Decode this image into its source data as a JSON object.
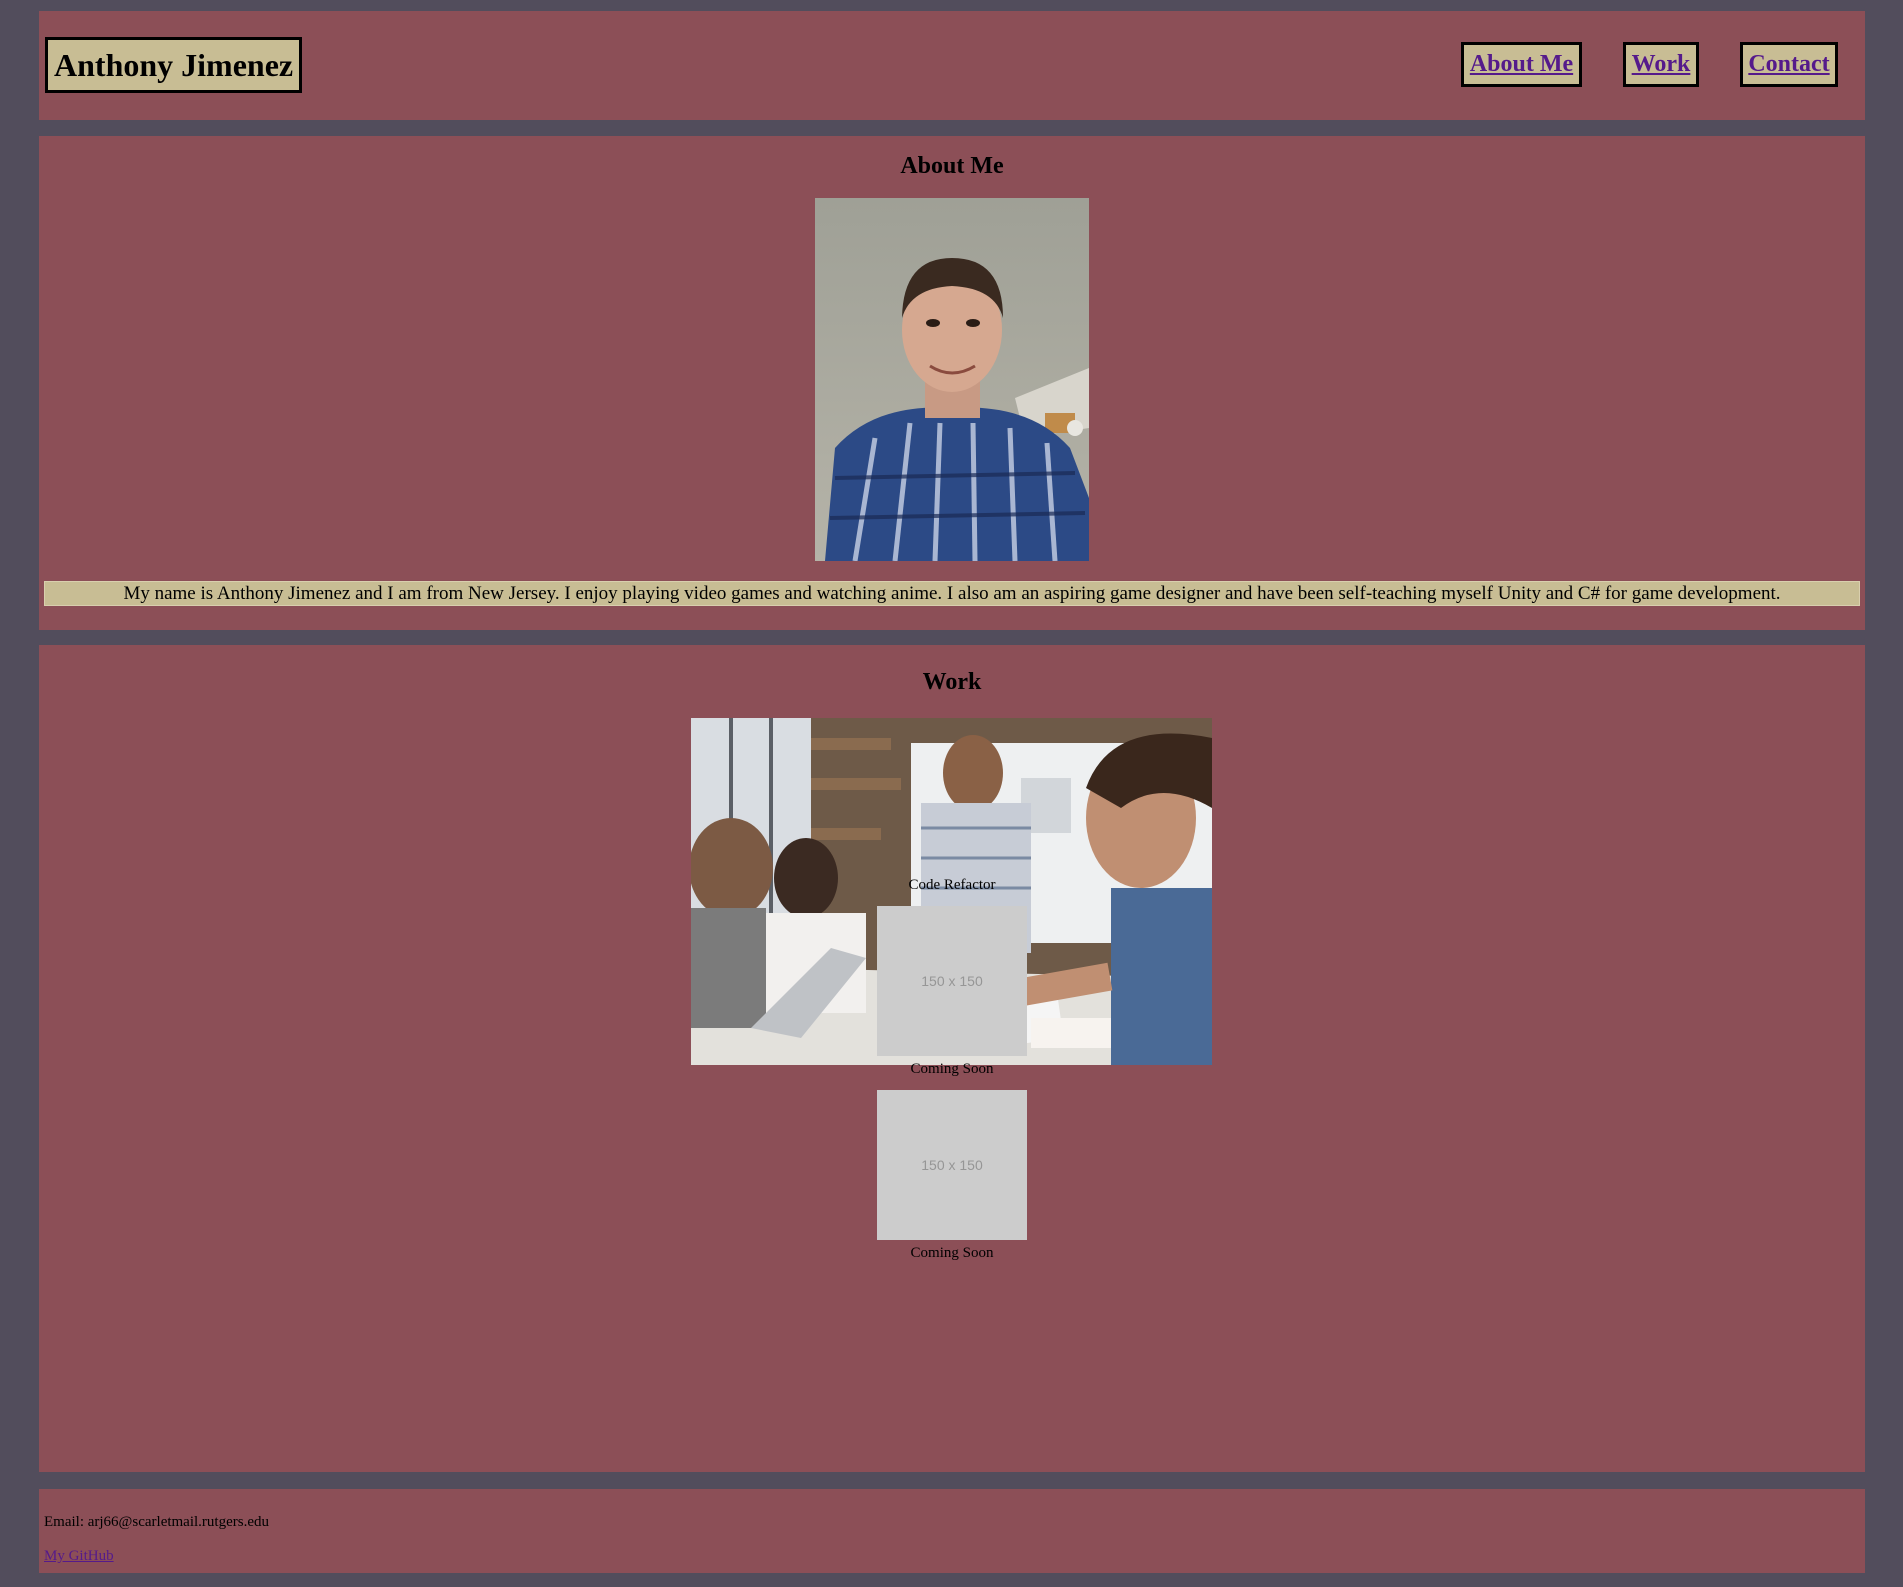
{
  "header": {
    "brand": "Anthony Jimenez",
    "nav": [
      {
        "label": "About Me"
      },
      {
        "label": "Work"
      },
      {
        "label": "Contact"
      }
    ]
  },
  "about": {
    "title": "About Me",
    "bio": "My name is Anthony Jimenez and I am from New Jersey. I enjoy playing video games and watching anime. I also am an aspiring game designer and have been self-teaching myself Unity and C# for game development."
  },
  "work": {
    "title": "Work",
    "items": [
      {
        "caption": "Code Refactor"
      },
      {
        "placeholder": "150 x 150",
        "caption": "Coming Soon"
      },
      {
        "placeholder": "150 x 150",
        "caption": "Coming Soon"
      }
    ]
  },
  "footer": {
    "email_text": "Email: arj66@scarletmail.rutgers.edu",
    "github_label": "My GitHub"
  },
  "colors": {
    "page_bg": "#524d5c",
    "panel_bg": "#8c4f57",
    "accent_bg": "#c8bd94",
    "link": "#551a8b"
  }
}
